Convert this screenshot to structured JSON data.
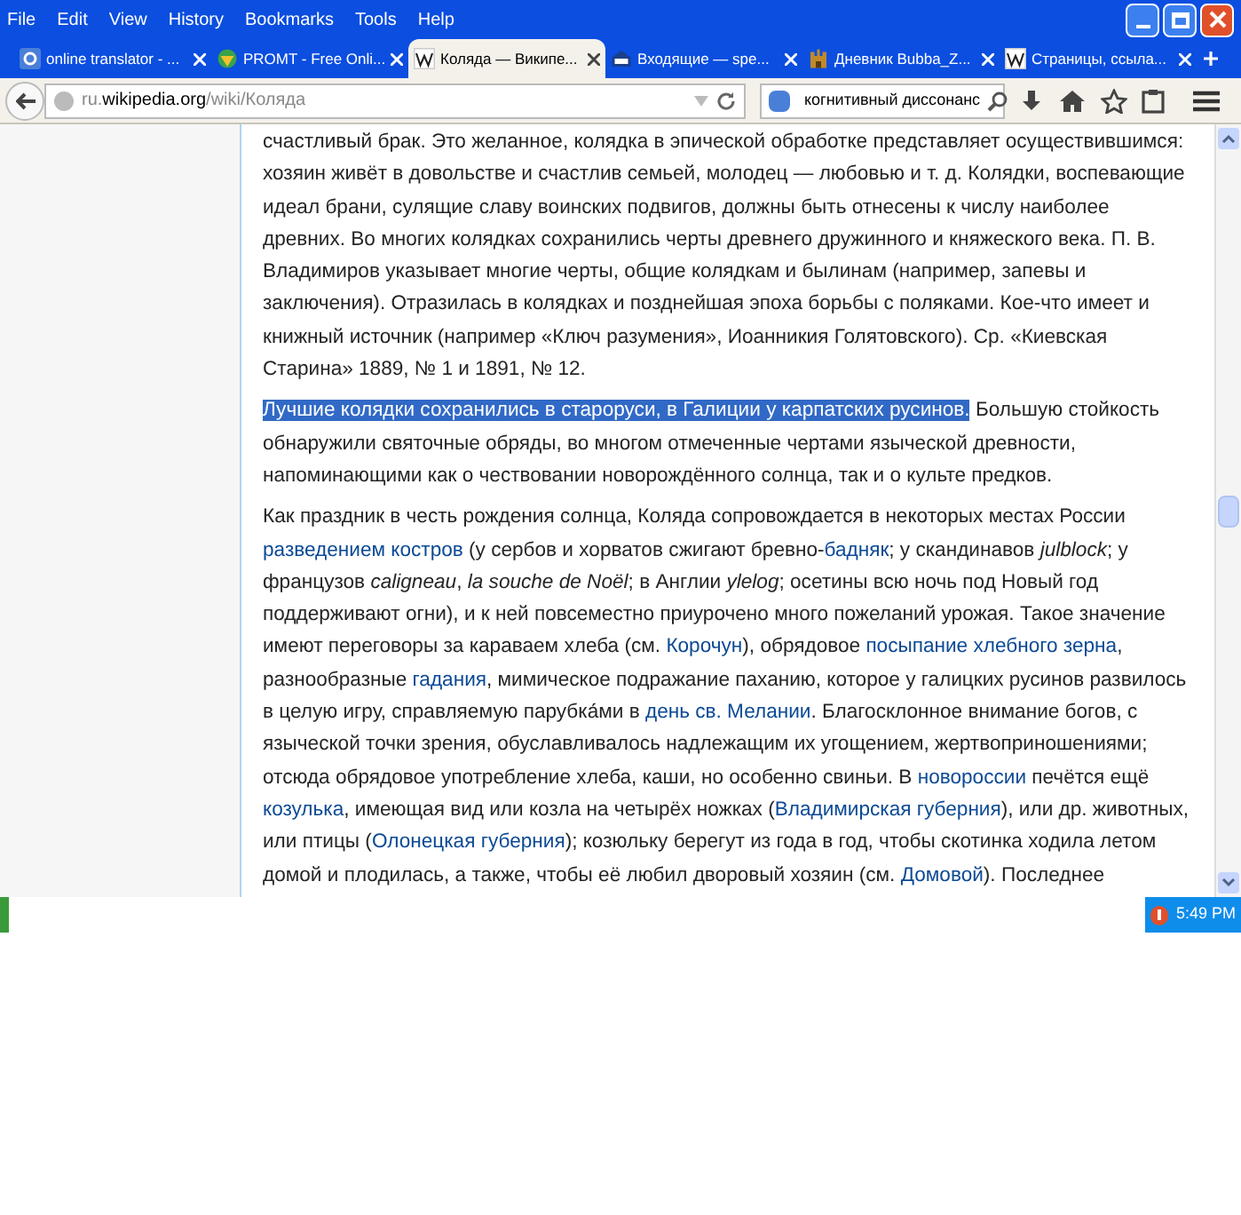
{
  "menu": [
    "File",
    "Edit",
    "View",
    "History",
    "Bookmarks",
    "Tools",
    "Help"
  ],
  "tabs": [
    {
      "label": "online translator - ...",
      "selected": false
    },
    {
      "label": "PROMT - Free Onli...",
      "selected": false
    },
    {
      "label": "Коляда — Википе...",
      "selected": true
    },
    {
      "label": "Входящие — spe...",
      "selected": false
    },
    {
      "label": "Дневник Bubba_Z...",
      "selected": false
    },
    {
      "label": "Страницы, ссыла...",
      "selected": false
    }
  ],
  "address": {
    "host_prefix": "ru.",
    "host": "wikipedia.org",
    "path": "/wiki/Коляда"
  },
  "search": {
    "value": "когнитивный диссонанс"
  },
  "paragraphs": [
    {
      "segments": [
        {
          "kind": "text",
          "text": "счастливый брак. Это желанное, колядка в эпической обработке представляет осуществившимся: хозяин живёт в довольстве и счастлив семьей, молодец — любовью и т. д. Колядки, воспевающие идеал брани, сулящие славу воинских подвигов, должны быть отнесены к числу наиболее древних. Во многих колядках сохранились черты древнего дружинного и княжеского века. П. В. Владимиров указывает многие черты, общие колядкам и былинам (например, запевы и заключения). Отразилась в колядках и позднейшая эпоха борьбы с поляками. Кое-что имеет и книжный источник (например «Ключ разумения», Иоанникия Голятовского). Ср. «Киевская Старина» 1889, № 1 и 1891, № 12."
        }
      ]
    },
    {
      "segments": [
        {
          "kind": "selected",
          "text": "Лучшие колядки сохранились в староруси, в Галиции у карпатских русинов."
        },
        {
          "kind": "text",
          "text": " Большую стойкость обнаружили святочные обряды, во многом отмеченные чертами языческой древности, напоминающими как о чествовании новорождённого солнца, так и о культе предков."
        }
      ]
    },
    {
      "segments": [
        {
          "kind": "text",
          "text": "Как праздник в честь рождения солнца, Коляда сопровождается в некоторых местах России "
        },
        {
          "kind": "link",
          "text": "разведением костров"
        },
        {
          "kind": "text",
          "text": " (у сербов и хорватов сжигают бревно-"
        },
        {
          "kind": "link",
          "text": "бадняк"
        },
        {
          "kind": "text",
          "text": "; у скандинавов "
        },
        {
          "kind": "italic",
          "text": "julblock"
        },
        {
          "kind": "text",
          "text": "; у французов "
        },
        {
          "kind": "italic",
          "text": "caligneau"
        },
        {
          "kind": "text",
          "text": ", "
        },
        {
          "kind": "italic",
          "text": "la souche de Noël"
        },
        {
          "kind": "text",
          "text": "; в Англии "
        },
        {
          "kind": "italic",
          "text": "ylelog"
        },
        {
          "kind": "text",
          "text": "; осетины всю ночь под Новый год поддерживают огни), и к ней повсеместно приурочено много пожеланий урожая. Такое значение имеют переговоры за караваем хлеба (см. "
        },
        {
          "kind": "link",
          "text": "Корочун"
        },
        {
          "kind": "text",
          "text": "), обрядовое "
        },
        {
          "kind": "link",
          "text": "посыпание хлебного зерна"
        },
        {
          "kind": "text",
          "text": ", разнообразные "
        },
        {
          "kind": "link",
          "text": "гадания"
        },
        {
          "kind": "text",
          "text": ", мимическое подражание паханию, которое у галицких русинов развилось в целую игру, справляемую парубка́ми в "
        },
        {
          "kind": "link",
          "text": "день св. Мелании"
        },
        {
          "kind": "text",
          "text": ". Благосклонное внимание богов, с языческой точки зрения, обуславливалось надлежащим их угощением, жертвоприношениями; отсюда обрядовое употребление хлеба, каши, но особенно свиньи. В "
        },
        {
          "kind": "link",
          "text": "новороссии"
        },
        {
          "kind": "text",
          "text": " печётся ещё "
        },
        {
          "kind": "link",
          "text": "козулька"
        },
        {
          "kind": "text",
          "text": ", имеющая вид или козла на четырёх ножках ("
        },
        {
          "kind": "link",
          "text": "Владимирская губерния"
        },
        {
          "kind": "text",
          "text": "), или др. животных, или птицы ("
        },
        {
          "kind": "link",
          "text": "Олонецкая губерния"
        },
        {
          "kind": "text",
          "text": "); козюльку берегут из года в год, чтобы скотинка ходила летом домой и плодилась, а также, чтобы её любил дворовый хозяин (см. "
        },
        {
          "kind": "link",
          "text": "Домовой"
        },
        {
          "kind": "text",
          "text": "). Последнее"
        }
      ]
    }
  ],
  "tray": {
    "time": "5:49 PM"
  }
}
